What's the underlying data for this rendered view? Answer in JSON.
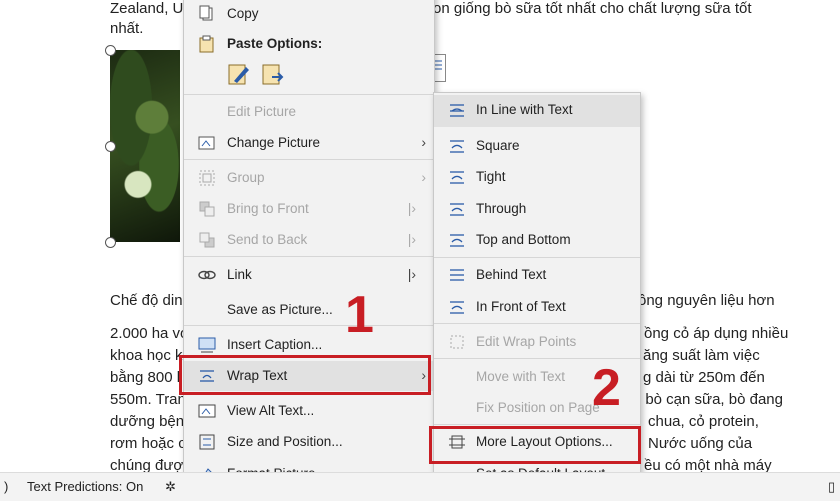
{
  "document": {
    "lines": [
      {
        "left": "Zealand, U",
        "right": "on giống bò sữa tốt nhất cho chất lượng sữa tốt"
      },
      {
        "left": "nhất."
      },
      {
        "left": "Chế độ din",
        "right": "ông nguyên liệu hơn"
      },
      {
        "left": "2.000 ha vớ",
        "right": "ồng cỏ áp dụng nhiều"
      },
      {
        "left": "khoa học k",
        "right": "ăng suất làm việc"
      },
      {
        "left": "bằng 800 l",
        "right": "g dài từ 250m đến"
      },
      {
        "left": "550m. Tran",
        "right": ", bò cạn sữa, bò đang"
      },
      {
        "left": "dưỡng bện",
        "right": "chua, cỏ protein,"
      },
      {
        "left": "rơm hoặc c",
        "right": "Nước uống của"
      },
      {
        "left": "chúng đượ",
        "right": "ều có một nhà máy"
      }
    ]
  },
  "context_menu": {
    "copy": "Copy",
    "paste_options": "Paste Options:",
    "items": [
      {
        "label": "Edit Picture",
        "disabled": true
      },
      {
        "label": "Change Picture",
        "has_submenu": true
      },
      {
        "label": "Group",
        "disabled": true,
        "has_submenu": true
      },
      {
        "label": "Bring to Front",
        "disabled": true,
        "has_submenu": true
      },
      {
        "label": "Send to Back",
        "disabled": true,
        "has_submenu": true
      },
      {
        "label": "Link",
        "has_submenu": true
      },
      {
        "label": "Save as Picture..."
      },
      {
        "label": "Insert Caption..."
      },
      {
        "label": "Wrap Text",
        "has_submenu": true
      },
      {
        "label": "View Alt Text..."
      },
      {
        "label": "Size and Position..."
      },
      {
        "label": "Format Picture..."
      }
    ]
  },
  "wrap_submenu": {
    "items": [
      {
        "label": "In Line with Text",
        "selected": true
      },
      {
        "label": "Square"
      },
      {
        "label": "Tight"
      },
      {
        "label": "Through"
      },
      {
        "label": "Top and Bottom"
      },
      {
        "label": "Behind Text"
      },
      {
        "label": "In Front of Text"
      },
      {
        "label": "Edit Wrap Points",
        "disabled": true
      },
      {
        "label": "Move with Text",
        "disabled": true
      },
      {
        "label": "Fix Position on Page",
        "disabled": true
      },
      {
        "label": "More Layout Options..."
      },
      {
        "label": "Set as Default Layout"
      }
    ]
  },
  "annotations": {
    "step1": "1",
    "step2": "2"
  },
  "status_bar": {
    "text_predictions": "Text Predictions: On"
  },
  "colors": {
    "highlight": "#c81e24",
    "menu_bg": "#f2f2f2",
    "icon_blue": "#2b5ca8"
  }
}
